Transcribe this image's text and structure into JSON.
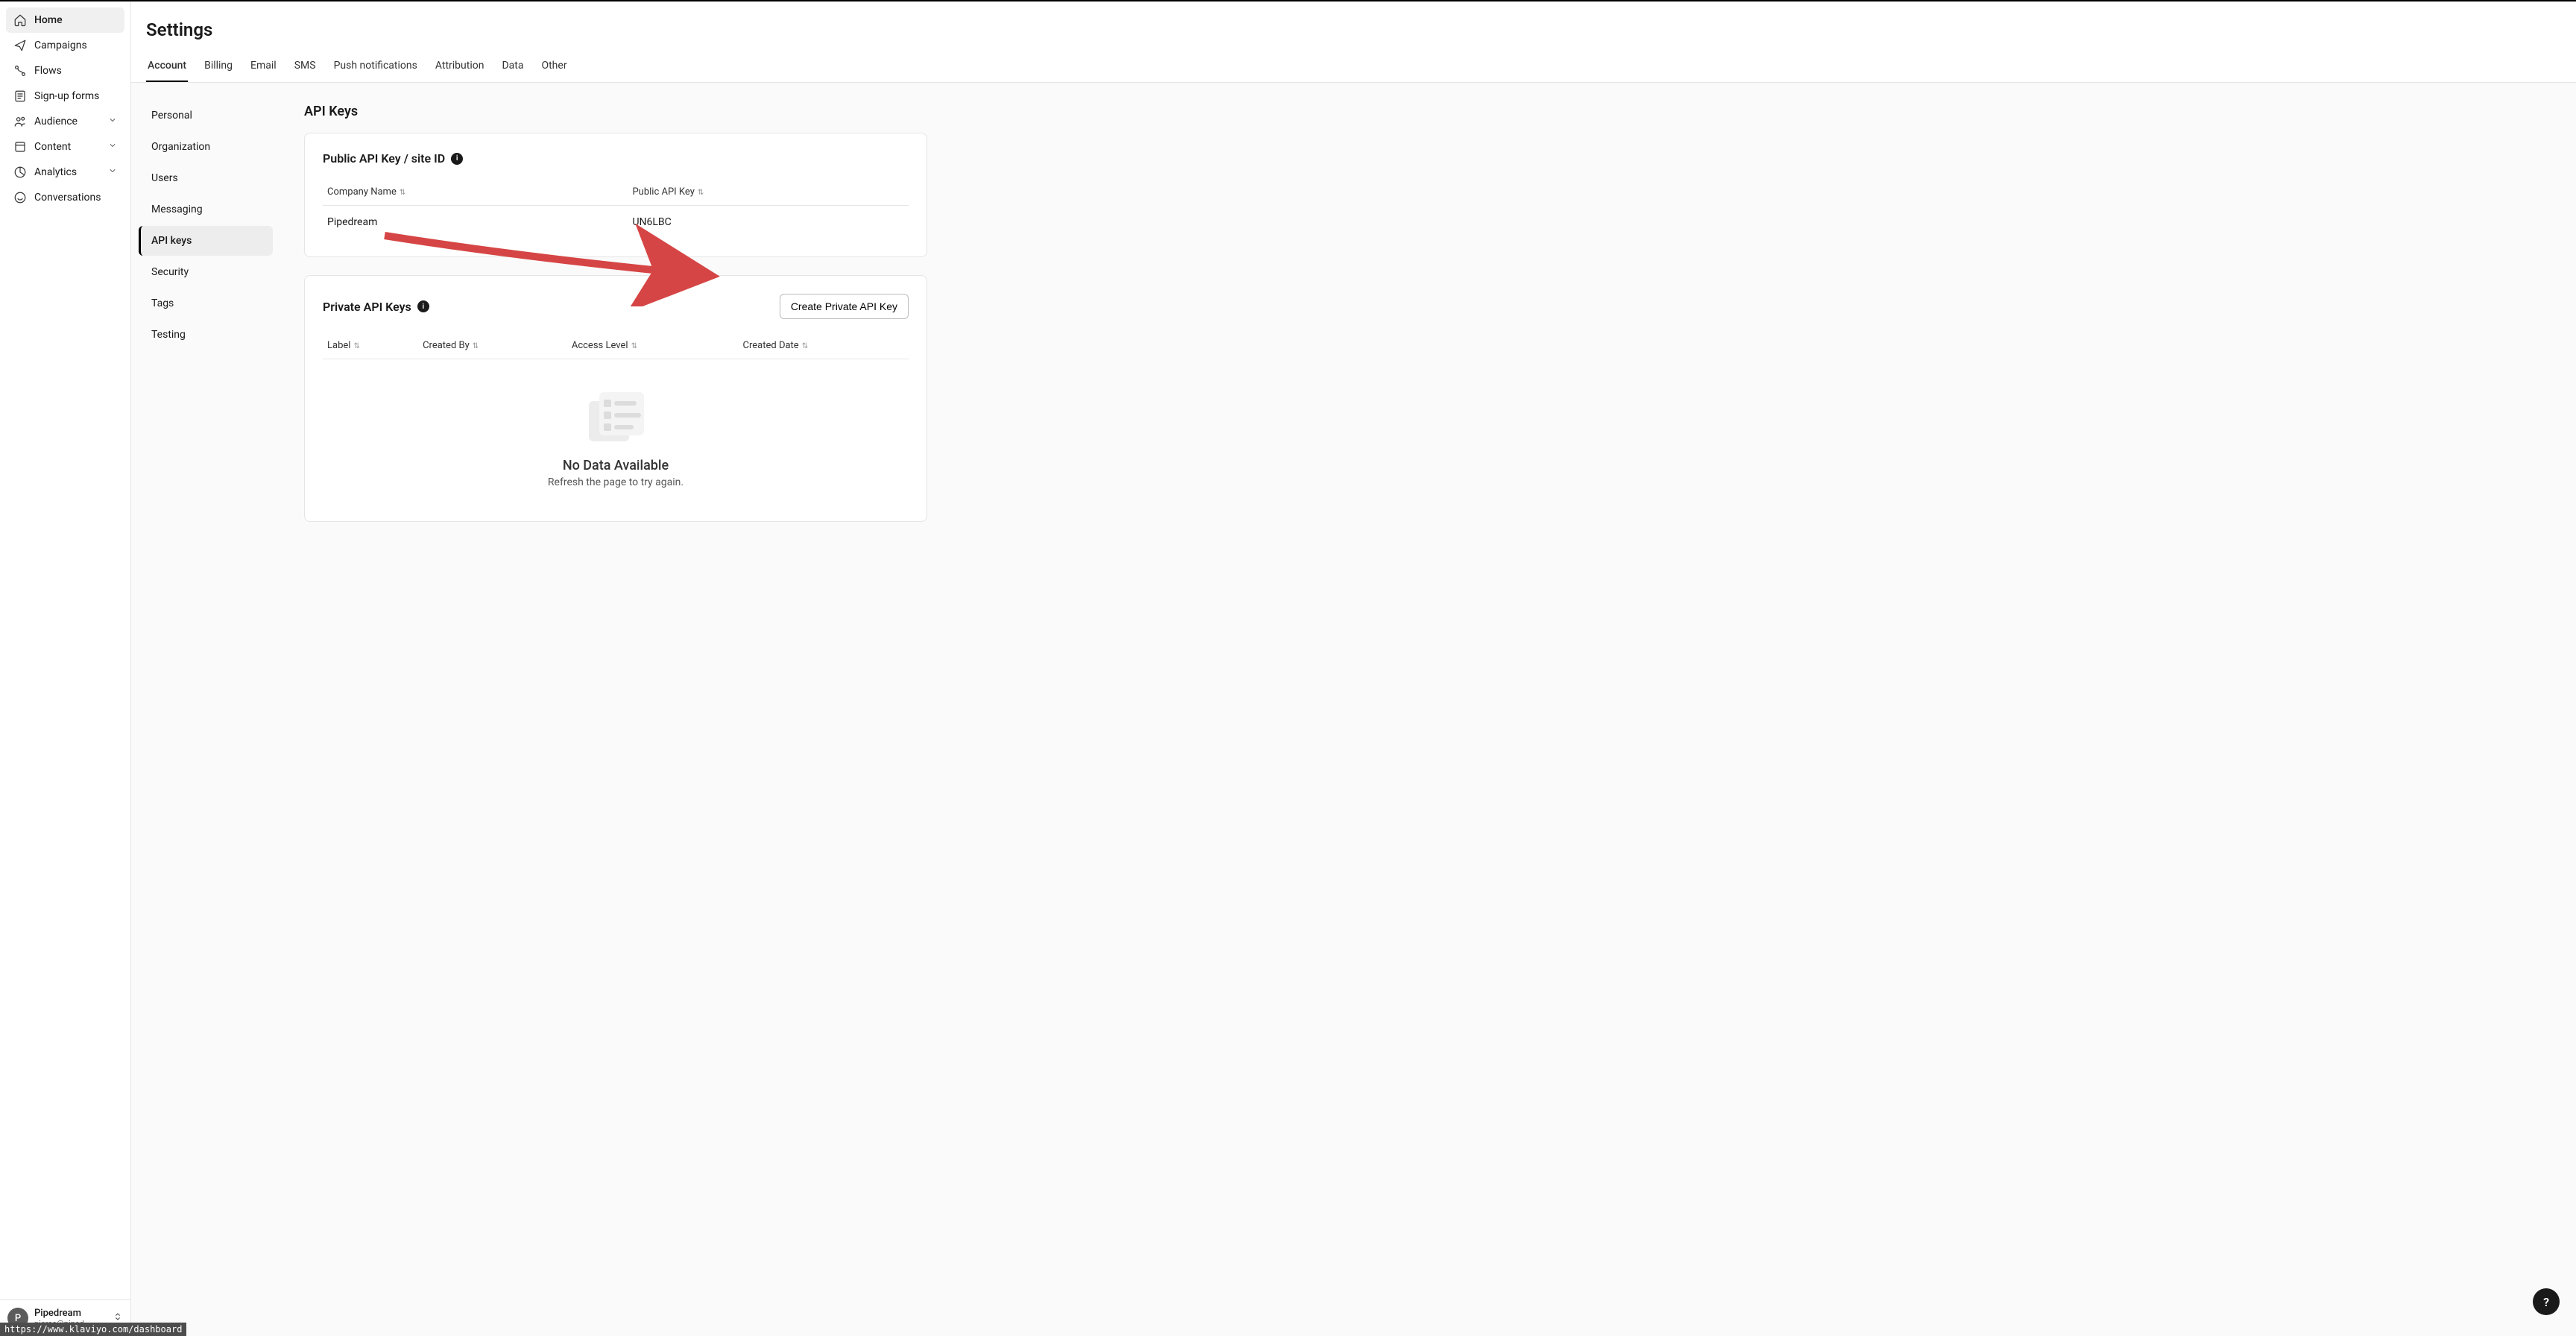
{
  "sidebar": {
    "items": [
      {
        "label": "Home",
        "icon": "home"
      },
      {
        "label": "Campaigns",
        "icon": "send"
      },
      {
        "label": "Flows",
        "icon": "flow"
      },
      {
        "label": "Sign-up forms",
        "icon": "form"
      },
      {
        "label": "Audience",
        "icon": "audience",
        "chevron": true
      },
      {
        "label": "Content",
        "icon": "content",
        "chevron": true
      },
      {
        "label": "Analytics",
        "icon": "analytics",
        "chevron": true
      },
      {
        "label": "Conversations",
        "icon": "chat"
      }
    ],
    "user": {
      "initial": "P",
      "name": "Pipedream",
      "email": "pierce@piped…"
    }
  },
  "page": {
    "title": "Settings"
  },
  "tabs": [
    {
      "label": "Account",
      "active": true
    },
    {
      "label": "Billing"
    },
    {
      "label": "Email"
    },
    {
      "label": "SMS"
    },
    {
      "label": "Push notifications"
    },
    {
      "label": "Attribution"
    },
    {
      "label": "Data"
    },
    {
      "label": "Other"
    }
  ],
  "subnav": [
    {
      "label": "Personal"
    },
    {
      "label": "Organization"
    },
    {
      "label": "Users"
    },
    {
      "label": "Messaging"
    },
    {
      "label": "API keys",
      "active": true
    },
    {
      "label": "Security"
    },
    {
      "label": "Tags"
    },
    {
      "label": "Testing"
    }
  ],
  "apiKeys": {
    "sectionTitle": "API Keys",
    "publicCard": {
      "title": "Public API Key / site ID",
      "columns": [
        "Company Name",
        "Public API Key"
      ],
      "rows": [
        {
          "company": "Pipedream",
          "key": "UN6LBC"
        }
      ]
    },
    "privateCard": {
      "title": "Private API Keys",
      "createBtn": "Create Private API Key",
      "columns": [
        "Label",
        "Created By",
        "Access Level",
        "Created Date"
      ],
      "emptyTitle": "No Data Available",
      "emptySub": "Refresh the page to try again."
    }
  },
  "statusUrl": "https://www.klaviyo.com/dashboard",
  "helpLabel": "?"
}
